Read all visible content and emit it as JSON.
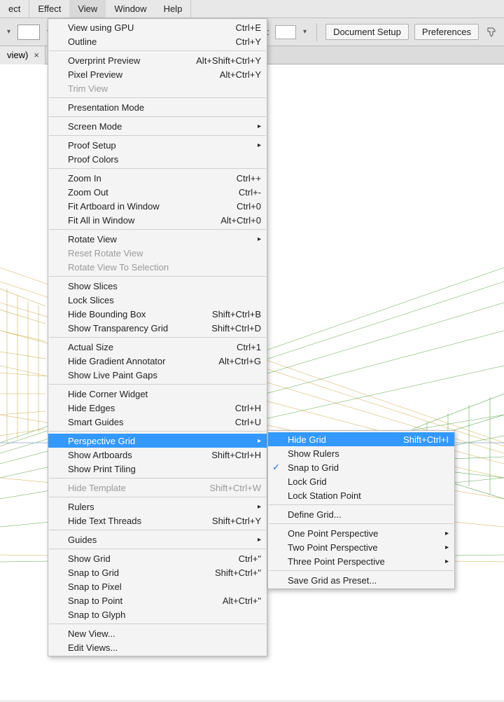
{
  "menubar": {
    "items": [
      "ect",
      "Effect",
      "View",
      "Window",
      "Help"
    ],
    "active_index": 2
  },
  "toolbar": {
    "style_label": "Style:",
    "doc_setup": "Document Setup",
    "prefs": "Preferences"
  },
  "tab": {
    "title": "view)",
    "close": "×"
  },
  "view_menu": {
    "g0": [
      {
        "label": "View using GPU",
        "shortcut": "Ctrl+E"
      },
      {
        "label": "Outline",
        "shortcut": "Ctrl+Y"
      }
    ],
    "g1": [
      {
        "label": "Overprint Preview",
        "shortcut": "Alt+Shift+Ctrl+Y"
      },
      {
        "label": "Pixel Preview",
        "shortcut": "Alt+Ctrl+Y"
      },
      {
        "label": "Trim View",
        "disabled": true
      }
    ],
    "g2": [
      {
        "label": "Presentation Mode"
      }
    ],
    "g3": [
      {
        "label": "Screen Mode",
        "submenu": true
      }
    ],
    "g4": [
      {
        "label": "Proof Setup",
        "submenu": true
      },
      {
        "label": "Proof Colors"
      }
    ],
    "g5": [
      {
        "label": "Zoom In",
        "shortcut": "Ctrl++"
      },
      {
        "label": "Zoom Out",
        "shortcut": "Ctrl+-"
      },
      {
        "label": "Fit Artboard in Window",
        "shortcut": "Ctrl+0"
      },
      {
        "label": "Fit All in Window",
        "shortcut": "Alt+Ctrl+0"
      }
    ],
    "g6": [
      {
        "label": "Rotate View",
        "submenu": true
      },
      {
        "label": "Reset Rotate View",
        "disabled": true
      },
      {
        "label": "Rotate View To Selection",
        "disabled": true
      }
    ],
    "g7": [
      {
        "label": "Show Slices"
      },
      {
        "label": "Lock Slices"
      },
      {
        "label": "Hide Bounding Box",
        "shortcut": "Shift+Ctrl+B"
      },
      {
        "label": "Show Transparency Grid",
        "shortcut": "Shift+Ctrl+D"
      }
    ],
    "g8": [
      {
        "label": "Actual Size",
        "shortcut": "Ctrl+1"
      },
      {
        "label": "Hide Gradient Annotator",
        "shortcut": "Alt+Ctrl+G"
      },
      {
        "label": "Show Live Paint Gaps"
      }
    ],
    "g9": [
      {
        "label": "Hide Corner Widget"
      },
      {
        "label": "Hide Edges",
        "shortcut": "Ctrl+H"
      },
      {
        "label": "Smart Guides",
        "shortcut": "Ctrl+U"
      }
    ],
    "g10": [
      {
        "label": "Perspective Grid",
        "submenu": true,
        "highlight": true
      },
      {
        "label": "Show Artboards",
        "shortcut": "Shift+Ctrl+H"
      },
      {
        "label": "Show Print Tiling"
      }
    ],
    "g11": [
      {
        "label": "Hide Template",
        "shortcut": "Shift+Ctrl+W",
        "disabled": true
      }
    ],
    "g12": [
      {
        "label": "Rulers",
        "submenu": true
      },
      {
        "label": "Hide Text Threads",
        "shortcut": "Shift+Ctrl+Y"
      }
    ],
    "g13": [
      {
        "label": "Guides",
        "submenu": true
      }
    ],
    "g14": [
      {
        "label": "Show Grid",
        "shortcut": "Ctrl+\""
      },
      {
        "label": "Snap to Grid",
        "shortcut": "Shift+Ctrl+\""
      },
      {
        "label": "Snap to Pixel"
      },
      {
        "label": "Snap to Point",
        "shortcut": "Alt+Ctrl+\""
      },
      {
        "label": "Snap to Glyph"
      }
    ],
    "g15": [
      {
        "label": "New View..."
      },
      {
        "label": "Edit Views..."
      }
    ]
  },
  "perspective_submenu": {
    "g0": [
      {
        "label": "Hide Grid",
        "shortcut": "Shift+Ctrl+I",
        "highlight": true
      },
      {
        "label": "Show Rulers"
      },
      {
        "label": "Snap to Grid",
        "checked": true
      },
      {
        "label": "Lock Grid"
      },
      {
        "label": "Lock Station Point"
      }
    ],
    "g1": [
      {
        "label": "Define Grid..."
      }
    ],
    "g2": [
      {
        "label": "One Point Perspective",
        "submenu": true
      },
      {
        "label": "Two Point Perspective",
        "submenu": true
      },
      {
        "label": "Three Point Perspective",
        "submenu": true
      }
    ],
    "g3": [
      {
        "label": "Save Grid as Preset..."
      }
    ]
  }
}
